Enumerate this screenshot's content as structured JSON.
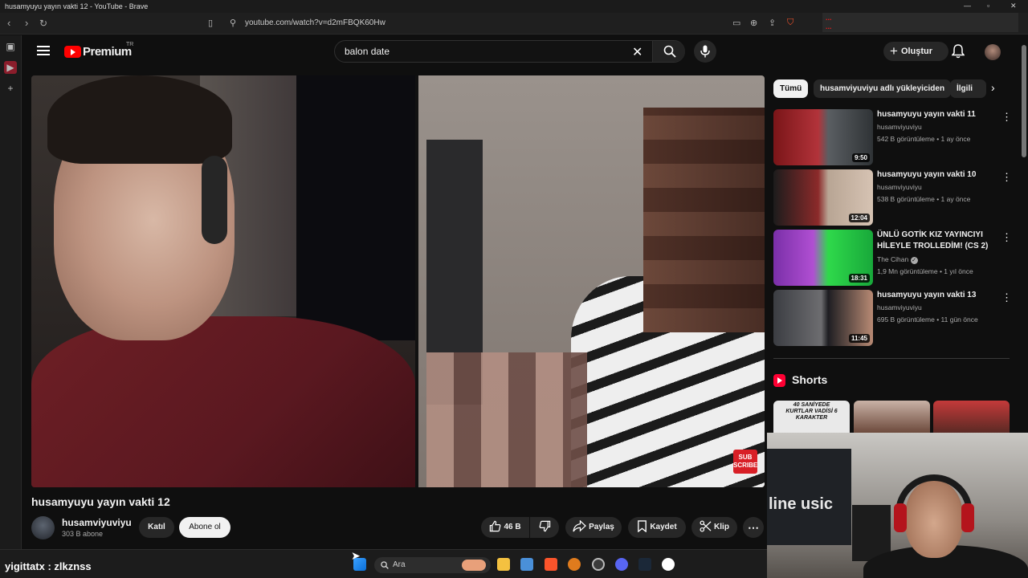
{
  "browser": {
    "window_title": "husamyuyu yayın vakti 12 - YouTube - Brave",
    "url": "youtube.com/watch?v=d2mFBQK60Hw",
    "ticker_lines": [
      "...",
      "..."
    ]
  },
  "header": {
    "logo_text": "Premium",
    "logo_region": "TR",
    "search_value": "balon date",
    "create_label": "Oluştur"
  },
  "video": {
    "overlay_logo": "SUB SCRIBE",
    "title": "husamyuyu yayın vakti 12",
    "channel_name": "husamviyuviyu",
    "subscribers": "303 B abone",
    "join_label": "Katıl",
    "subscribe_label": "Abone ol",
    "likes": "46 B",
    "share_label": "Paylaş",
    "save_label": "Kaydet",
    "clip_label": "Klip"
  },
  "chips": [
    "Tümü",
    "husamviyuviyu adlı yükleyiciden",
    "İlgili"
  ],
  "recommendations": [
    {
      "title": "husamyuyu yayın vakti 11",
      "channel": "husamviyuviyu",
      "meta": "542 B görüntüleme • 1 ay önce",
      "duration": "9:50",
      "verified": false
    },
    {
      "title": "husamyuyu yayın vakti 10",
      "channel": "husamviyuviyu",
      "meta": "538 B görüntüleme • 1 ay önce",
      "duration": "12:04",
      "verified": false
    },
    {
      "title": "ÜNLÜ GOTİK KIZ YAYINCIYI HİLEYLE TROLLEDİM! (CS 2)",
      "channel": "The Cihan",
      "meta": "1,9 Mn görüntüleme • 1 yıl önce",
      "duration": "18:31",
      "verified": true
    },
    {
      "title": "husamyuyu yayın vakti 13",
      "channel": "husamviyuviyu",
      "meta": "695 B görüntüleme • 11 gün önce",
      "duration": "11:45",
      "verified": false
    }
  ],
  "shorts": {
    "heading": "Shorts",
    "first_caption": "40 SANİYEDE KURTLAR VADİSİ 6 KARAKTER"
  },
  "webcam": {
    "monitor_text": "line usic"
  },
  "taskbar": {
    "chat_line": "yigittatx : zlkznss",
    "search_placeholder": "Ara"
  },
  "colors": {
    "bg": "#0f0f0f",
    "brand_red": "#ff0000",
    "pill_bg": "#272727"
  }
}
